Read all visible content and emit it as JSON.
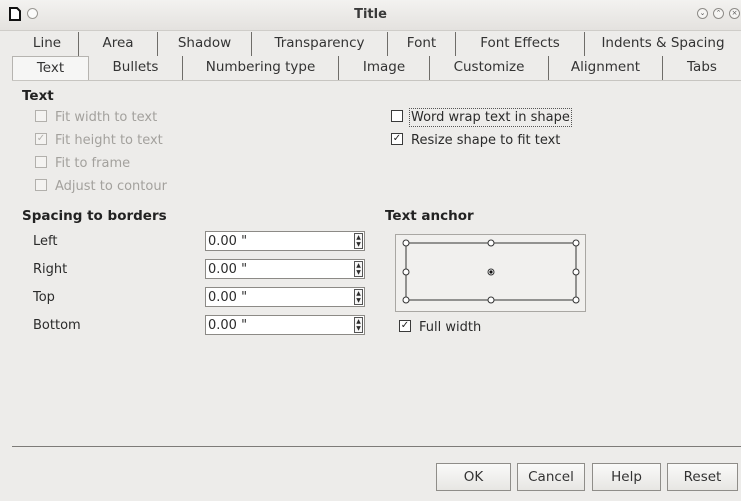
{
  "window": {
    "title": "Title"
  },
  "tabs": {
    "row1": [
      "Line",
      "Area",
      "Shadow",
      "Transparency",
      "Font",
      "Font Effects",
      "Indents & Spacing"
    ],
    "row2": [
      "Text",
      "Bullets",
      "Numbering type",
      "Image",
      "Customize",
      "Alignment",
      "Tabs"
    ],
    "selected": "Text"
  },
  "text_section": {
    "heading": "Text",
    "options": [
      {
        "label": "Fit width to text",
        "checked": false,
        "enabled": false
      },
      {
        "label": "Fit height to text",
        "checked": true,
        "enabled": false
      },
      {
        "label": "Fit to frame",
        "checked": false,
        "enabled": false
      },
      {
        "label": "Adjust to contour",
        "checked": false,
        "enabled": false
      }
    ],
    "right_options": [
      {
        "label": "Word wrap text in shape",
        "checked": false,
        "enabled": true
      },
      {
        "label": "Resize shape to fit text",
        "checked": true,
        "enabled": true
      }
    ]
  },
  "spacing": {
    "heading": "Spacing to borders",
    "fields": [
      {
        "label": "Left",
        "value": "0.00 \""
      },
      {
        "label": "Right",
        "value": "0.00 \""
      },
      {
        "label": "Top",
        "value": "0.00 \""
      },
      {
        "label": "Bottom",
        "value": "0.00 \""
      }
    ]
  },
  "anchor": {
    "heading": "Text anchor",
    "selected_position": "center",
    "full_width_label": "Full width",
    "full_width_checked": true
  },
  "buttons": {
    "ok": "OK",
    "cancel": "Cancel",
    "help": "Help",
    "reset": "Reset"
  },
  "icons": {
    "app": "document-icon",
    "minimize": "chevron-down-icon",
    "maximize": "chevron-up-icon",
    "close": "close-icon"
  }
}
